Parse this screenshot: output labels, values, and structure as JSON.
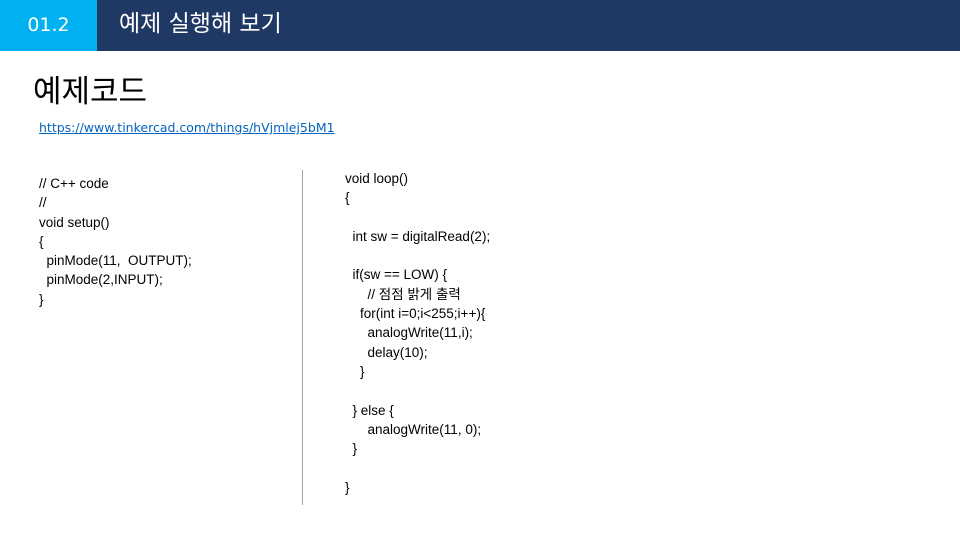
{
  "header": {
    "section_number": "01.2",
    "title": "예제 실행해 보기",
    "colors": {
      "bar": "#1f3864",
      "section": "#00b0f0"
    }
  },
  "page_title": "예제코드",
  "link_text": "https://www.tinkercad.com/things/hVjmlej5bM1",
  "code_left": "// C++ code\n//\nvoid setup()\n{\n  pinMode(11,  OUTPUT);\n  pinMode(2,INPUT);\n}",
  "code_right": "void loop()\n{\n\n  int sw = digitalRead(2);\n\n  if(sw == LOW) {\n\t// 점점 밝게 출력\n    for(int i=0;i<255;i++){\n\tanalogWrite(11,i);\n\tdelay(10);\n    }\n\n  } else {\n\tanalogWrite(11, 0);\n  }\n\n}"
}
